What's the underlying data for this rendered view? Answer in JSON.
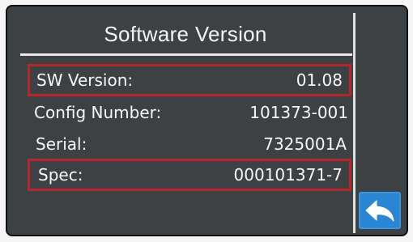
{
  "screen": {
    "title": "Software Version"
  },
  "rows": [
    {
      "label": "SW Version:",
      "value": "01.08",
      "highlighted": true
    },
    {
      "label": "Config Number:",
      "value": "101373-001",
      "highlighted": false
    },
    {
      "label": "Serial:",
      "value": "7325001A",
      "highlighted": false
    },
    {
      "label": "Spec:",
      "value": "000101371-7",
      "highlighted": true
    }
  ],
  "back_button": {
    "icon": "back-arrow-icon"
  },
  "colors": {
    "screen_background": "#3d4144",
    "highlight_border": "#b3262c",
    "back_button": "#2a86d4",
    "text": "#f7f7f7"
  }
}
